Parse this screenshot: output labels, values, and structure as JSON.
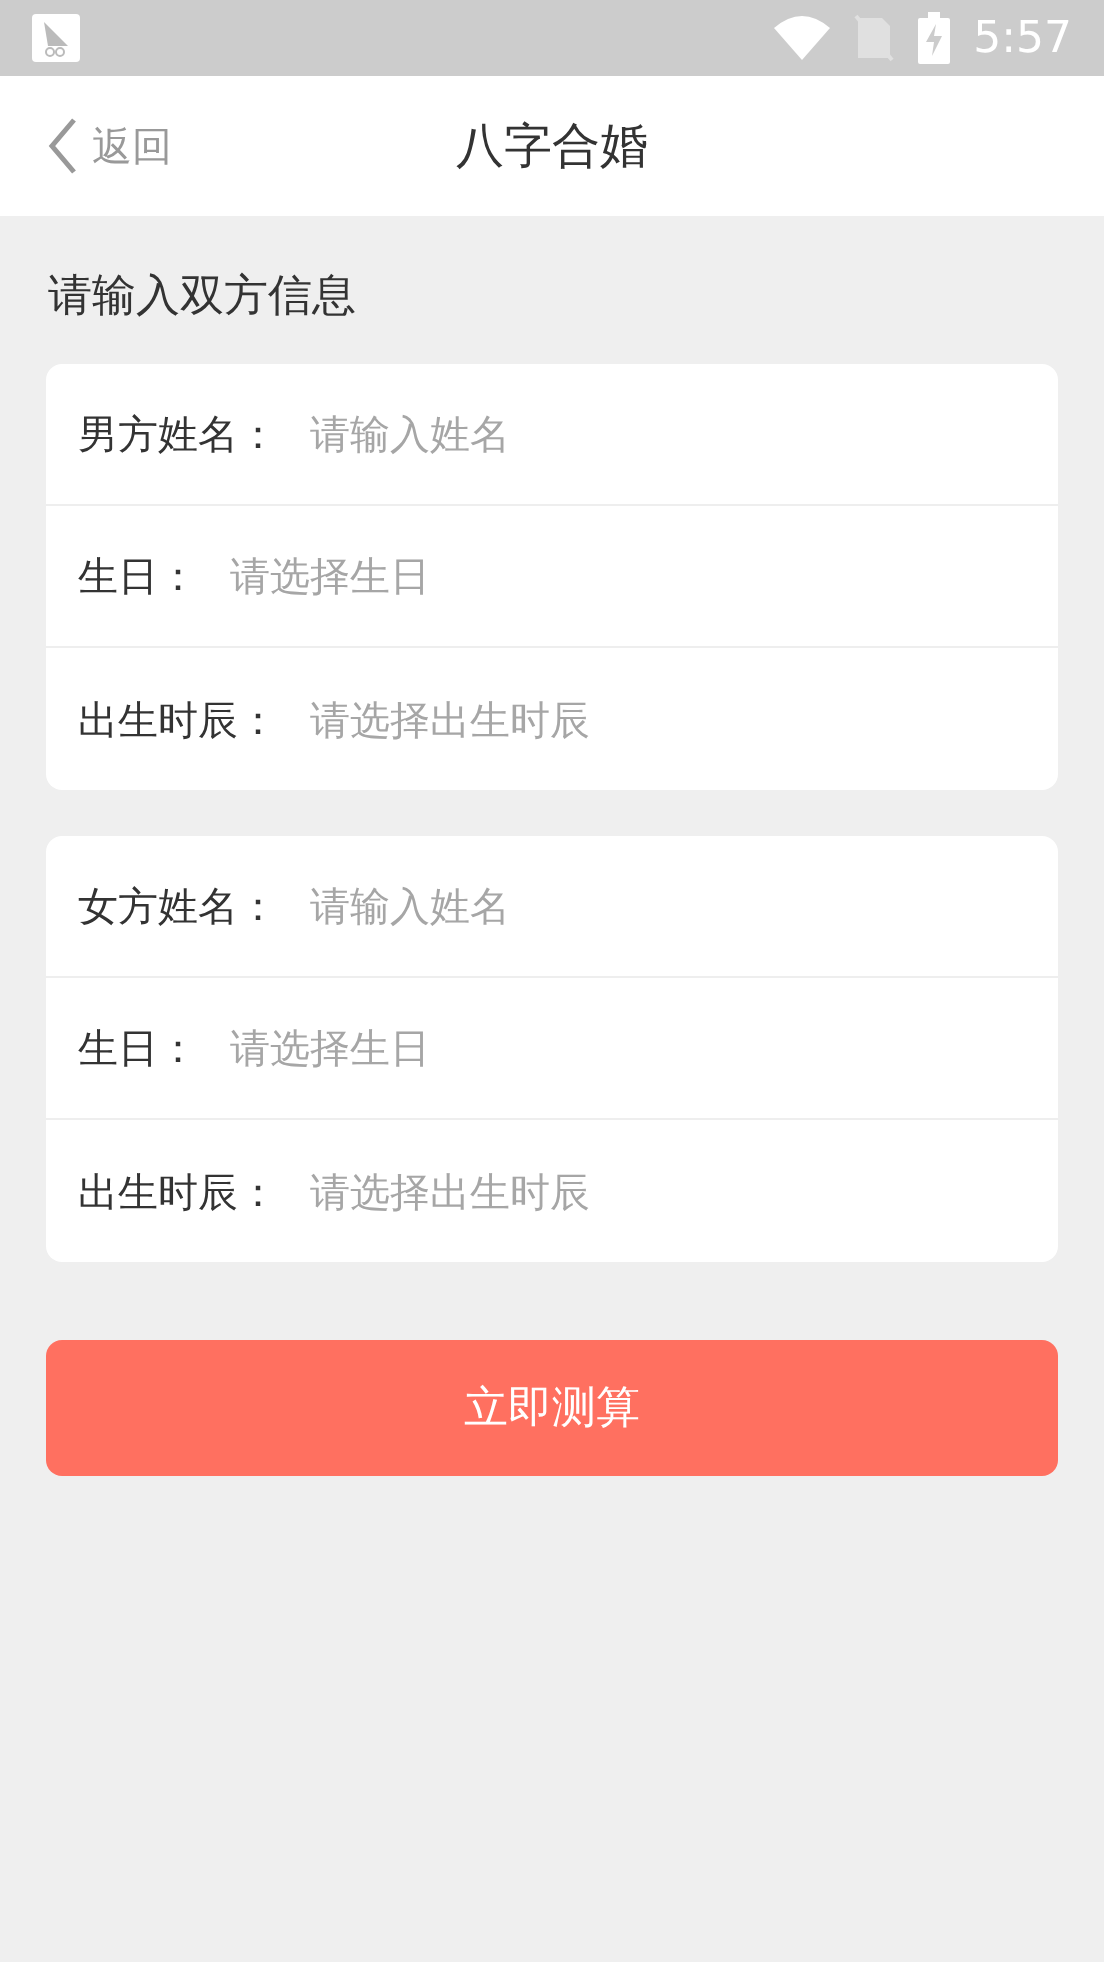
{
  "status_bar": {
    "time": "5:57"
  },
  "nav": {
    "back": "返回",
    "title": "八字合婚"
  },
  "section_title": "请输入双方信息",
  "groups": [
    {
      "fields": [
        {
          "label": "男方姓名：",
          "placeholder": "请输入姓名"
        },
        {
          "label": "生日：",
          "placeholder": "请选择生日"
        },
        {
          "label": "出生时辰：",
          "placeholder": "请选择出生时辰"
        }
      ]
    },
    {
      "fields": [
        {
          "label": "女方姓名：",
          "placeholder": "请输入姓名"
        },
        {
          "label": "生日：",
          "placeholder": "请选择生日"
        },
        {
          "label": "出生时辰：",
          "placeholder": "请选择出生时辰"
        }
      ]
    }
  ],
  "submit": "立即测算"
}
